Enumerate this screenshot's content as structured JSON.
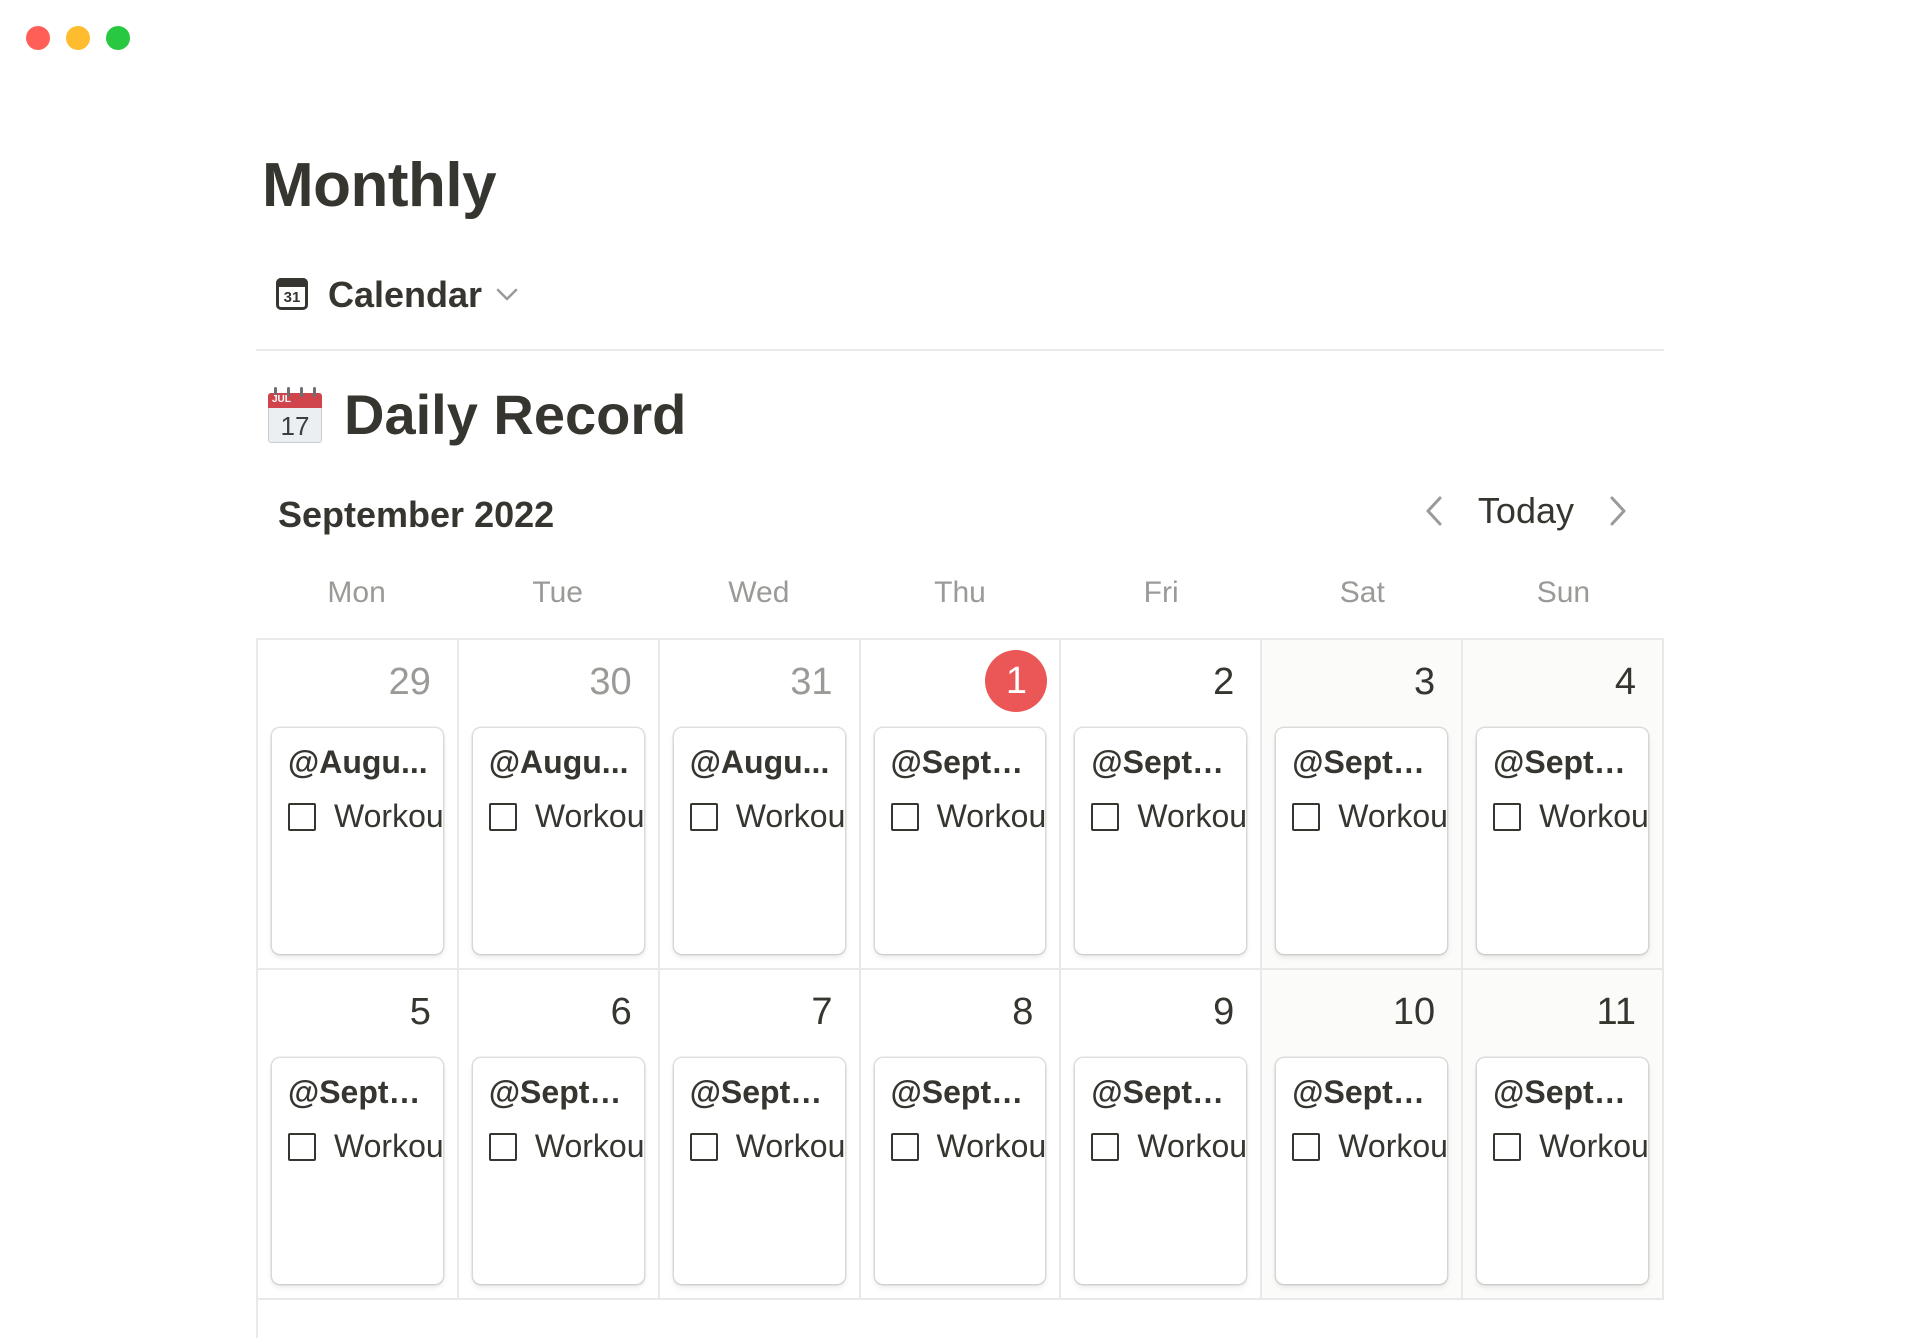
{
  "window": {
    "traffic_lights": [
      "#ff5f57",
      "#febc2e",
      "#28c840"
    ]
  },
  "page": {
    "title": "Monthly"
  },
  "view": {
    "label": "Calendar",
    "icon": "calendar-icon",
    "icon_day": "31"
  },
  "database": {
    "title": "Daily Record",
    "emoji": "tear-off-calendar-icon",
    "emoji_month": "JUL",
    "emoji_day": "17"
  },
  "calendar": {
    "month": "September 2022",
    "today_label": "Today",
    "weekdays": [
      "Mon",
      "Tue",
      "Wed",
      "Thu",
      "Fri",
      "Sat",
      "Sun"
    ],
    "accent": "#eb5757",
    "weeks": [
      [
        {
          "day": "29",
          "muted": true,
          "weekend": false,
          "today": false,
          "card_title": "@Augu...",
          "checkbox_label": "Workou",
          "checked": false
        },
        {
          "day": "30",
          "muted": true,
          "weekend": false,
          "today": false,
          "card_title": "@Augu...",
          "checkbox_label": "Workou",
          "checked": false
        },
        {
          "day": "31",
          "muted": true,
          "weekend": false,
          "today": false,
          "card_title": "@Augu...",
          "checkbox_label": "Workou",
          "checked": false
        },
        {
          "day": "1",
          "muted": false,
          "weekend": false,
          "today": true,
          "card_title": "@Septe...",
          "checkbox_label": "Workou",
          "checked": false
        },
        {
          "day": "2",
          "muted": false,
          "weekend": false,
          "today": false,
          "card_title": "@Septe...",
          "checkbox_label": "Workou",
          "checked": false
        },
        {
          "day": "3",
          "muted": false,
          "weekend": true,
          "today": false,
          "card_title": "@Septe...",
          "checkbox_label": "Workou",
          "checked": false
        },
        {
          "day": "4",
          "muted": false,
          "weekend": true,
          "today": false,
          "card_title": "@Septe...",
          "checkbox_label": "Workou",
          "checked": false
        }
      ],
      [
        {
          "day": "5",
          "muted": false,
          "weekend": false,
          "today": false,
          "card_title": "@Septe...",
          "checkbox_label": "Workou",
          "checked": false
        },
        {
          "day": "6",
          "muted": false,
          "weekend": false,
          "today": false,
          "card_title": "@Septe...",
          "checkbox_label": "Workou",
          "checked": false
        },
        {
          "day": "7",
          "muted": false,
          "weekend": false,
          "today": false,
          "card_title": "@Septe...",
          "checkbox_label": "Workou",
          "checked": false
        },
        {
          "day": "8",
          "muted": false,
          "weekend": false,
          "today": false,
          "card_title": "@Septe...",
          "checkbox_label": "Workou",
          "checked": false
        },
        {
          "day": "9",
          "muted": false,
          "weekend": false,
          "today": false,
          "card_title": "@Septe...",
          "checkbox_label": "Workou",
          "checked": false
        },
        {
          "day": "10",
          "muted": false,
          "weekend": true,
          "today": false,
          "card_title": "@Septe...",
          "checkbox_label": "Workou",
          "checked": false
        },
        {
          "day": "11",
          "muted": false,
          "weekend": true,
          "today": false,
          "card_title": "@Septe...",
          "checkbox_label": "Workou",
          "checked": false
        }
      ]
    ]
  }
}
